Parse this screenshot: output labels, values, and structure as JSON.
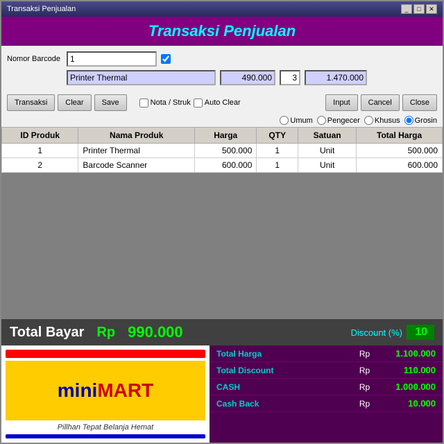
{
  "window": {
    "title": "Transaksi Penjualan",
    "controls": [
      "_",
      "□",
      "✕"
    ]
  },
  "header": {
    "title": "Transaksi Penjualan"
  },
  "form": {
    "nomor_barcode_label": "Nomor Barcode",
    "barcode_value": "1",
    "product_name_value": "Printer Thermal",
    "price_value": "490.000",
    "qty_value": "3",
    "total_value": "1.470.000"
  },
  "buttons": {
    "transaksi": "Transaksi",
    "clear": "Clear",
    "save": "Save",
    "nota_struk": "Nota / Struk",
    "auto_clear": "Auto Clear",
    "input": "Input",
    "cancel": "Cancel",
    "close": "Close"
  },
  "radio_options": [
    {
      "label": "Umum",
      "selected": false
    },
    {
      "label": "Pengecer",
      "selected": false
    },
    {
      "label": "Khusus",
      "selected": false
    },
    {
      "label": "Grosin",
      "selected": true
    }
  ],
  "table": {
    "headers": [
      "ID Produk",
      "Nama Produk",
      "Harga",
      "QTY",
      "Satuan",
      "Total Harga"
    ],
    "rows": [
      {
        "id": "1",
        "nama": "Printer Thermal",
        "harga": "500.000",
        "qty": "1",
        "satuan": "Unit",
        "total": "500.000"
      },
      {
        "id": "2",
        "nama": "Barcode Scanner",
        "harga": "600.000",
        "qty": "1",
        "satuan": "Unit",
        "total": "600.000"
      }
    ]
  },
  "total_section": {
    "label": "Total Bayar",
    "rp": "Rp",
    "amount": "990.000",
    "discount_label": "Discount (%)",
    "discount_value": "10"
  },
  "minimart": {
    "mini": "mini",
    "mart": "MART",
    "tagline": "Pillhan Tepat Belanja Hemat"
  },
  "totals_panel": [
    {
      "label": "Total Harga",
      "rp": "Rp",
      "value": "1.100.000"
    },
    {
      "label": "Total Discount",
      "rp": "Rp",
      "value": "110.000"
    },
    {
      "label": "CASH",
      "rp": "Rp",
      "value": "1.000.000"
    },
    {
      "label": "Cash Back",
      "rp": "Rp",
      "value": "10.000"
    }
  ]
}
